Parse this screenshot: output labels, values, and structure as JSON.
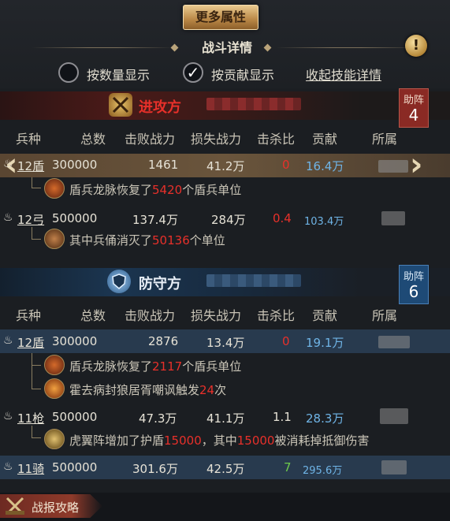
{
  "top": {
    "more_attributes": "更多属性",
    "battle_detail_title": "战斗详情",
    "warn_icon_glyph": "!",
    "options": {
      "by_count": "按数量显示",
      "by_contribution": "按贡献显示",
      "check_glyph": "✓",
      "collapse_skills": "收起技能详情"
    }
  },
  "columns": [
    "兵种",
    "总数",
    "击败战力",
    "损失战力",
    "击杀比",
    "贡献",
    "所属"
  ],
  "attacker": {
    "title": "进攻方",
    "assist_label": "助阵",
    "assist_count": "4",
    "rows": [
      {
        "unit": "12盾",
        "total": "300000",
        "defeated": "1461",
        "lost": "41.2万",
        "ratio": "0",
        "contribution": "16.4万",
        "notes": [
          {
            "pre": "盾兵龙脉恢复了",
            "num": "5420",
            "post": "个盾兵单位"
          }
        ]
      },
      {
        "unit": "12弓",
        "total": "500000",
        "defeated": "137.4万",
        "lost": "284万",
        "ratio": "0.4",
        "contribution": "103.4万",
        "notes": [
          {
            "pre": "其中兵俑消灭了",
            "num": "50136",
            "post": "个单位"
          }
        ]
      }
    ]
  },
  "defender": {
    "title": "防守方",
    "assist_label": "助阵",
    "assist_count": "6",
    "rows": [
      {
        "unit": "12盾",
        "total": "300000",
        "defeated": "2876",
        "lost": "13.4万",
        "ratio": "0",
        "contribution": "19.1万",
        "notes": [
          {
            "pre": "盾兵龙脉恢复了",
            "num": "2117",
            "post": "个盾兵单位"
          },
          {
            "pre": "霍去病封狼居胥嘲讽触发",
            "num": "24",
            "post": "次"
          }
        ]
      },
      {
        "unit": "11枪",
        "total": "500000",
        "defeated": "47.3万",
        "lost": "41.1万",
        "ratio": "1.1",
        "contribution": "28.3万",
        "notes": [
          {
            "pre": "虎翼阵增加了护盾",
            "num": "15000",
            "mid": "，其中",
            "num2": "15000",
            "post": "被消耗掉抵御伤害"
          }
        ]
      },
      {
        "unit": "11骑",
        "total": "500000",
        "defeated": "301.6万",
        "lost": "42.5万",
        "ratio": "7",
        "contribution": "295.6万",
        "notes": []
      }
    ]
  },
  "bottom": {
    "guide_tab": "战报攻略"
  },
  "nav": {
    "left_arrow": "‹",
    "right_arrow": "›"
  },
  "colors": {
    "red": "#e8302a",
    "blue": "#6fb4e6",
    "green": "#6dc94c",
    "gold": "#b98746"
  }
}
